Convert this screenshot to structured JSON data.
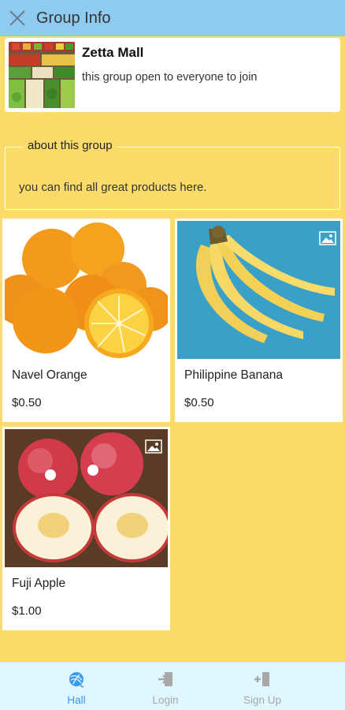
{
  "header": {
    "title": "Group Info"
  },
  "group": {
    "name": "Zetta Mall",
    "description": "this group open to everyone to join"
  },
  "about": {
    "legend": "about this group",
    "text": "you can find all great products here."
  },
  "products": [
    {
      "name": "Navel Orange",
      "price": "$0.50"
    },
    {
      "name": "Philippine Banana",
      "price": "$0.50"
    },
    {
      "name": "Fuji Apple",
      "price": "$1.00"
    }
  ],
  "bottom_nav": [
    {
      "label": "Hall",
      "icon": "yarn-ball-icon",
      "active": true
    },
    {
      "label": "Login",
      "icon": "login-icon",
      "active": false
    },
    {
      "label": "Sign Up",
      "icon": "sign-up-icon",
      "active": false
    }
  ],
  "colors": {
    "topbar": "#8fcbf0",
    "background": "#fbdc6a",
    "bottombar": "#dff7ff",
    "nav_active": "#3b9ae6",
    "nav_inactive": "#a8a8a8"
  }
}
